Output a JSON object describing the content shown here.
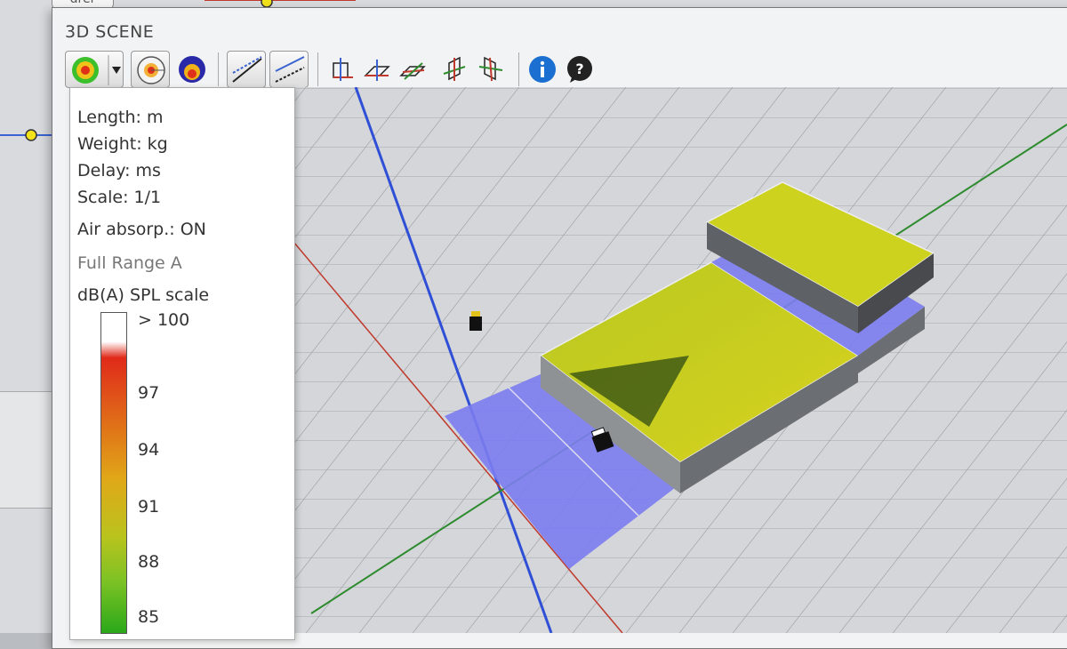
{
  "back_window": {
    "tab_label": "drer"
  },
  "scene": {
    "title": "3D SCENE",
    "toolbar": [
      {
        "name": "spl-mapping-dropdown-button",
        "icon": "spl-map-icon"
      },
      {
        "name": "spl-contour-button",
        "icon": "spl-contour-icon"
      },
      {
        "name": "spl-ball-button",
        "icon": "spl-ball-icon"
      },
      {
        "name": "ray-view-button",
        "icon": "ray-line-icon"
      },
      {
        "name": "ray-view-alt-button",
        "icon": "ray-line-alt-icon"
      },
      {
        "name": "view-front-button",
        "icon": "view-front-icon"
      },
      {
        "name": "view-top-button",
        "icon": "view-top-icon"
      },
      {
        "name": "view-side-button",
        "icon": "view-side-icon"
      },
      {
        "name": "view-left-button",
        "icon": "view-left-icon"
      },
      {
        "name": "view-right-button",
        "icon": "view-right-icon"
      },
      {
        "name": "info-button",
        "icon": "info-icon"
      },
      {
        "name": "help-button",
        "icon": "help-icon"
      }
    ]
  },
  "info": {
    "length": "Length: m",
    "weight": "Weight: kg",
    "delay": "Delay: ms",
    "scale": "Scale: 1/1",
    "air_absorption": "Air absorp.: ON",
    "range": "Full Range A",
    "scale_title": "dB(A) SPL scale"
  },
  "spl_scale": {
    "top_label": "> 100",
    "ticks": [
      "97",
      "94",
      "91",
      "88",
      "85"
    ],
    "colors": {
      "high": "#e02a1a",
      "mid": "#e0a818",
      "low": "#2aa81a"
    }
  },
  "axis_colors": {
    "x": "#c0392b",
    "y": "#2e8b2e",
    "z": "#2f4fd6"
  },
  "accent": {
    "info": "#1a6fd0",
    "help": "#222222",
    "audience_low": "#7c7cf0",
    "audience_high": "#c8d21c"
  }
}
